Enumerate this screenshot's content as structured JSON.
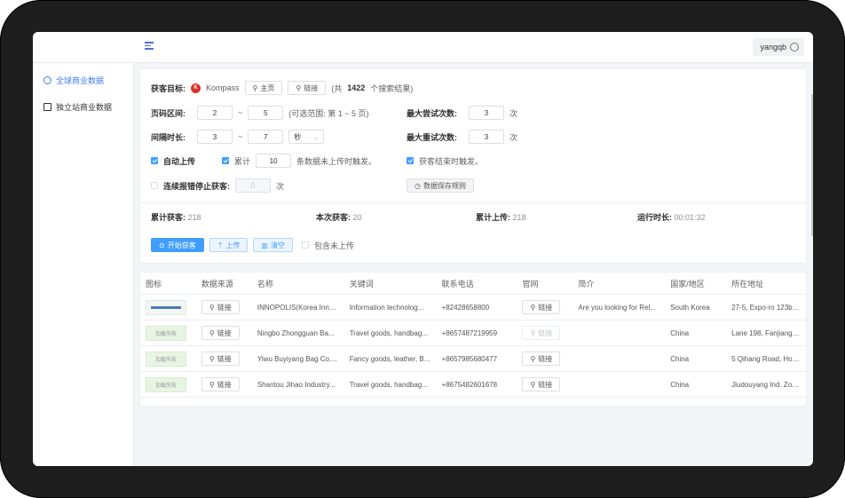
{
  "user": {
    "name": "yangqb"
  },
  "sidebar": {
    "items": [
      {
        "label": "全球商业数据",
        "active": true
      },
      {
        "label": "独立站商业数据",
        "active": false
      }
    ]
  },
  "form": {
    "target_label": "获客目标:",
    "source_name": "Kompass",
    "home_btn": "主页",
    "link_btn": "链接",
    "result_prefix": "(共",
    "result_count": "1422",
    "result_suffix": "个搜索结果)",
    "page_range_label": "页码区间:",
    "page_from": "2",
    "page_to": "5",
    "range_sep": "~",
    "page_hint": "(可选范围: 第 1 ~ 5 页)",
    "max_try_label": "最大尝试次数:",
    "max_try": "3",
    "times": "次",
    "interval_label": "间隔时长:",
    "interval_from": "3",
    "interval_to": "7",
    "interval_unit": "秒",
    "max_retry_label": "最大重试次数:",
    "max_retry": "3",
    "auto_upload": "自动上传",
    "accum_label": "累计",
    "accum_value": "10",
    "accum_hint": "条数据未上传时触发。",
    "finish_hint": "获客结束时触发。",
    "stop_label": "连续报错停止获客:",
    "stop_value": "0",
    "save_rule_btn": "数据保存规则"
  },
  "stats": [
    {
      "label": "累计获客:",
      "value": "218"
    },
    {
      "label": "本次获客:",
      "value": "20"
    },
    {
      "label": "累计上传:",
      "value": "218"
    },
    {
      "label": "运行时长:",
      "value": "00:01:32"
    }
  ],
  "actions": {
    "start": "开始获客",
    "upload": "上传",
    "clear": "清空",
    "include": "包含未上传"
  },
  "table": {
    "headers": [
      "图标",
      "数据来源",
      "名称",
      "关键词",
      "联系电话",
      "官网",
      "简介",
      "国家/地区",
      "所在地址"
    ],
    "link_text": "链接",
    "logo_fail": "加载失败",
    "rows": [
      {
        "name": "INNOPOLIS(Korea Inno...",
        "keyword": "Information technolog...",
        "phone": "+82428658800",
        "intro": "Are you looking for Rel...",
        "country": "South Korea",
        "address": "27-5, Expo-ro 123beon",
        "site_enabled": true
      },
      {
        "name": "Ningbo Zhongguan Ba...",
        "keyword": "Travel goods, handbag...",
        "phone": "+8657487219959",
        "intro": "",
        "country": "China",
        "address": "Lane 198, Fanjiang'an ...",
        "site_enabled": false
      },
      {
        "name": "Yiwu Buyiyang Bag Co....",
        "keyword": "Fancy goods, leather, B...",
        "phone": "+8657985680477",
        "intro": "",
        "country": "China",
        "address": "5 Qihang Road, Houzh...",
        "site_enabled": true
      },
      {
        "name": "Shantou Jihao Industry...",
        "keyword": "Travel goods, handbag...",
        "phone": "+8675482601678",
        "intro": "",
        "country": "China",
        "address": "Jiudouyang Ind. Zone, ...",
        "site_enabled": true
      }
    ]
  },
  "colors": {
    "primary": "#409eff",
    "accent_active": "#3f7de8",
    "kompass": "#d9322a"
  }
}
